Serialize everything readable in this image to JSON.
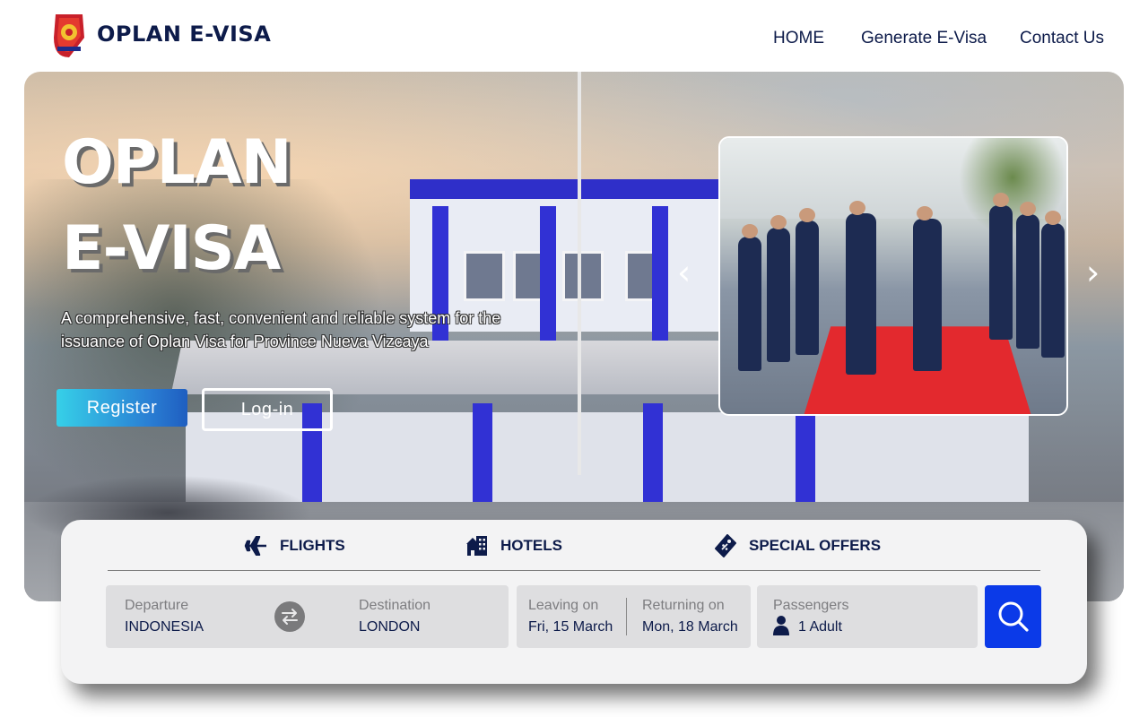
{
  "header": {
    "brand": "OPLAN E-VISA",
    "nav": {
      "home": "HOME",
      "generate": "Generate E-Visa",
      "contact": "Contact Us"
    }
  },
  "hero": {
    "title_line1": "OPLAN",
    "title_line2": "E-VISA",
    "subtitle": "A comprehensive, fast, convenient and reliable system for the issuance of Oplan Visa for Province Nueva Vizcaya",
    "register_label": "Register",
    "login_label": "Log-in",
    "carousel": {
      "prev_icon": "chevron-left-icon",
      "next_icon": "chevron-right-icon"
    }
  },
  "search": {
    "tabs": [
      {
        "label": "FLIGHTS",
        "icon": "airplane-icon"
      },
      {
        "label": "HOTELS",
        "icon": "hotel-icon"
      },
      {
        "label": "SPECIAL OFFERS",
        "icon": "tag-icon"
      }
    ],
    "departure": {
      "label": "Departure",
      "value": "INDONESIA"
    },
    "destination": {
      "label": "Destination",
      "value": "LONDON"
    },
    "leaving": {
      "label": "Leaving on",
      "value": "Fri, 15 March"
    },
    "returning": {
      "label": "Returning on",
      "value": "Mon, 18 March"
    },
    "passengers": {
      "label": "Passengers",
      "value": "1 Adult"
    },
    "search_icon": "search-icon",
    "swap_icon": "swap-icon"
  },
  "colors": {
    "brand_navy": "#0d1b4a",
    "search_button": "#0b3ae8",
    "register_gradient_start": "#36d0e8",
    "register_gradient_end": "#1f5ec0"
  }
}
